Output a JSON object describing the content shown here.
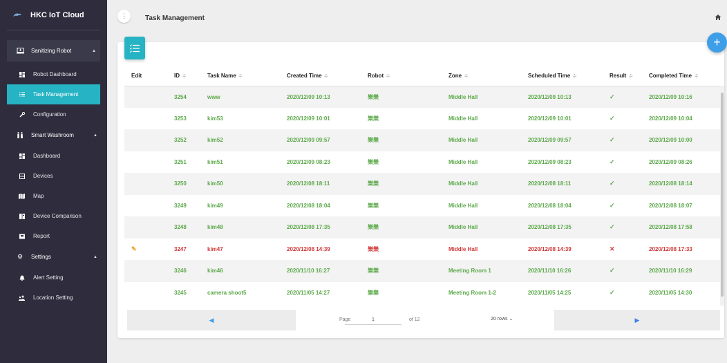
{
  "brand": {
    "name": "HKC IoT Cloud"
  },
  "sidebar": {
    "groups": [
      {
        "label": "Sanitizing Robot",
        "icon": "laptop-icon"
      },
      {
        "label": "Smart Washroom",
        "icon": "people-icon"
      },
      {
        "label": "Settings",
        "icon": "gear-icon"
      }
    ],
    "items": [
      {
        "label": "Robot Dashboard",
        "icon": "dashboard-icon"
      },
      {
        "label": "Task Management",
        "icon": "list-icon"
      },
      {
        "label": "Configuration",
        "icon": "wrench-icon"
      },
      {
        "label": "Dashboard",
        "icon": "dashboard-icon"
      },
      {
        "label": "Devices",
        "icon": "devices-icon"
      },
      {
        "label": "Map",
        "icon": "map-icon"
      },
      {
        "label": "Device Comparison",
        "icon": "compare-icon"
      },
      {
        "label": "Report",
        "icon": "report-icon"
      },
      {
        "label": "Alert Setting",
        "icon": "bell-icon"
      },
      {
        "label": "Location Setting",
        "icon": "location-icon"
      }
    ]
  },
  "header": {
    "title": "Task Management",
    "menu_glyph": "⋮"
  },
  "fab": {
    "label": "+"
  },
  "table": {
    "headers": {
      "edit": "Edit",
      "id": "ID",
      "task": "Task Name",
      "created": "Created Time",
      "robot": "Robot",
      "zone": "Zone",
      "scheduled": "Scheduled Time",
      "result": "Result",
      "completed": "Completed Time"
    },
    "sort_glyph": "≑",
    "rows": [
      {
        "id": "3254",
        "task": "www",
        "created": "2020/12/09 10:13",
        "robot": "樂樂",
        "zone": "Middle Hall",
        "scheduled": "2020/12/09 10:13",
        "result": "✓",
        "completed": "2020/12/09 10:16"
      },
      {
        "id": "3253",
        "task": "kim53",
        "created": "2020/12/09 10:01",
        "robot": "樂樂",
        "zone": "Middle Hall",
        "scheduled": "2020/12/09 10:01",
        "result": "✓",
        "completed": "2020/12/09 10:04"
      },
      {
        "id": "3252",
        "task": "kim52",
        "created": "2020/12/09 09:57",
        "robot": "樂樂",
        "zone": "Middle Hall",
        "scheduled": "2020/12/09 09:57",
        "result": "✓",
        "completed": "2020/12/09 10:00"
      },
      {
        "id": "3251",
        "task": "kim51",
        "created": "2020/12/09 08:23",
        "robot": "樂樂",
        "zone": "Middle Hall",
        "scheduled": "2020/12/09 08:23",
        "result": "✓",
        "completed": "2020/12/09 08:26"
      },
      {
        "id": "3250",
        "task": "kim50",
        "created": "2020/12/08 18:11",
        "robot": "樂樂",
        "zone": "Middle Hall",
        "scheduled": "2020/12/08 18:11",
        "result": "✓",
        "completed": "2020/12/08 18:14"
      },
      {
        "id": "3249",
        "task": "kim49",
        "created": "2020/12/08 18:04",
        "robot": "樂樂",
        "zone": "Middle Hall",
        "scheduled": "2020/12/08 18:04",
        "result": "✓",
        "completed": "2020/12/08 18:07"
      },
      {
        "id": "3248",
        "task": "kim48",
        "created": "2020/12/08 17:35",
        "robot": "樂樂",
        "zone": "Middle Hall",
        "scheduled": "2020/12/08 17:35",
        "result": "✓",
        "completed": "2020/12/08 17:58"
      },
      {
        "id": "3247",
        "task": "kim47",
        "created": "2020/12/08 14:39",
        "robot": "樂樂",
        "zone": "Middle Hall",
        "scheduled": "2020/12/08 14:39",
        "result": "✕",
        "completed": "2020/12/08 17:33",
        "failed": true,
        "editable": true
      },
      {
        "id": "3246",
        "task": "kim46",
        "created": "2020/11/10 16:27",
        "robot": "樂樂",
        "zone": "Meeting Room 1",
        "scheduled": "2020/11/10 16:26",
        "result": "✓",
        "completed": "2020/11/10 16:29"
      },
      {
        "id": "3245",
        "task": "camera shoot5",
        "created": "2020/11/05 14:27",
        "robot": "樂樂",
        "zone": "Meeting Room 1-2",
        "scheduled": "2020/11/05 14:25",
        "result": "✓",
        "completed": "2020/11/05 14:30"
      }
    ]
  },
  "pagination": {
    "page_label": "Page",
    "page_value": "1",
    "of_label": "of 12",
    "rows_label": "20 rows ⌄",
    "prev_glyph": "◀",
    "next_glyph": "▶"
  },
  "colors": {
    "sidebar": "#2f2d3d",
    "accent": "#26b3c3",
    "success": "#5ca94a",
    "error": "#d0393a",
    "fab": "#3e9ee8"
  }
}
